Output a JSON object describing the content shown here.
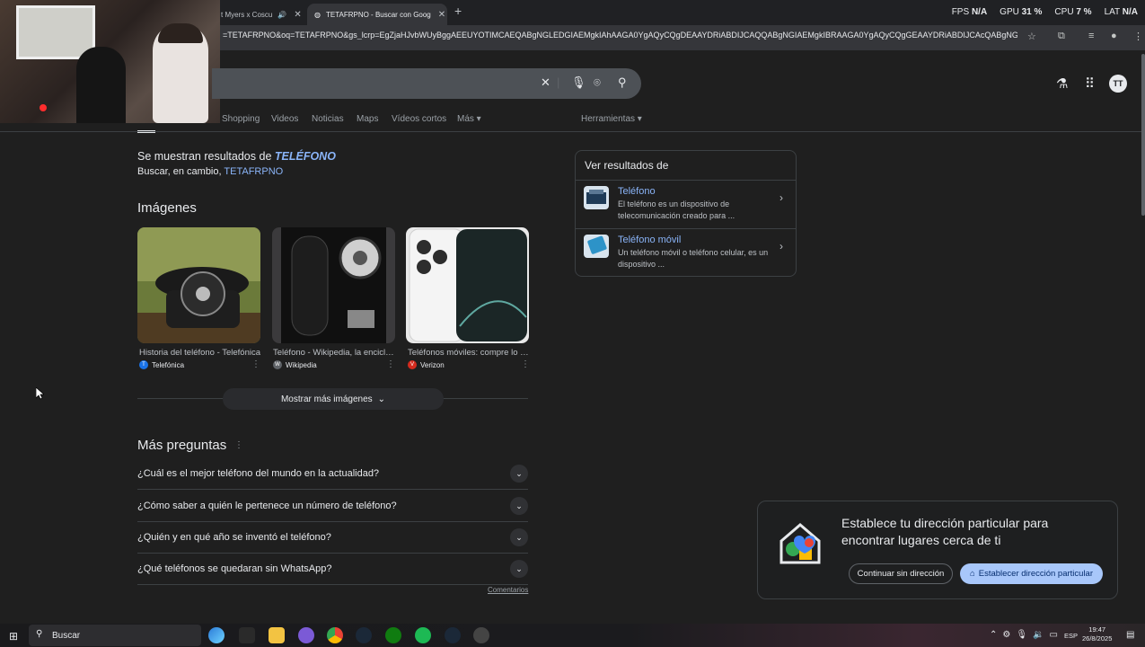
{
  "browser": {
    "tabs": [
      {
        "title": "t Myers x Coscu",
        "active": false
      },
      {
        "title": "TETAFRPNO - Buscar con Goog",
        "active": true
      }
    ],
    "new_tab": "+",
    "url": "=TETAFRPNO&oq=TETAFRPNO&gs_lcrp=EgZjaHJvbWUyBggAEEUYOTIMCAEQABgNGLEDGIAEMgkIAhAAGA0YgAQyCQgDEAAYDRiABDIJCAQQABgNGIAEMgkIBRAAGA0YgAQyCQgGEAAYDRiABDIJCAcQABgNGIAEM...",
    "stats": {
      "fps_label": "FPS",
      "fps_value": "N/A",
      "gpu_label": "GPU",
      "gpu_value": "31 %",
      "cpu_label": "CPU",
      "cpu_value": "7 %",
      "lat_label": "LAT",
      "lat_value": "N/A"
    }
  },
  "header": {
    "avatar_initials": "TT"
  },
  "nav": {
    "tabs": [
      "Shopping",
      "Videos",
      "Noticias",
      "Maps",
      "Vídeos cortos",
      "Más ▾"
    ],
    "tools": "Herramientas ▾"
  },
  "results": {
    "correction_prefix": "Se muestran resultados de ",
    "correction_term": "TELÉFONO",
    "instead_prefix": "Buscar, en cambio, ",
    "instead_term": "TETAFRPNO",
    "images_title": "Imágenes",
    "images": [
      {
        "caption": "Historia del teléfono - Telefónica",
        "source": "Telefónica",
        "badge": "T",
        "color": "#1a73e8"
      },
      {
        "caption": "Teléfono - Wikipedia, la enciclopedia libre",
        "source": "Wikipedia",
        "badge": "W",
        "color": "#5f6368"
      },
      {
        "caption": "Teléfonos móviles: compre lo último",
        "source": "Verizon",
        "badge": "V",
        "color": "#d52b1e"
      }
    ],
    "more_images": "Mostrar más imágenes",
    "paa_title": "Más preguntas",
    "questions": [
      "¿Cuál es el mejor teléfono del mundo en la actualidad?",
      "¿Cómo saber a quién le pertenece un número de teléfono?",
      "¿Quién y en qué año se inventó el teléfono?",
      "¿Qué teléfonos se quedaran sin WhatsApp?"
    ],
    "feedback": "Comentarios"
  },
  "side_panel": {
    "title": "Ver resultados de",
    "items": [
      {
        "name": "Teléfono",
        "desc": "El teléfono es un dispositivo de telecomunicación creado para ..."
      },
      {
        "name": "Teléfono móvil",
        "desc": "Un teléfono móvil o teléfono celular, es un dispositivo ..."
      }
    ]
  },
  "home_card": {
    "title": "Establece tu dirección particular para encontrar lugares cerca de ti",
    "continue_label": "Continuar sin dirección",
    "set_label": "Establecer dirección particular"
  },
  "taskbar": {
    "search_placeholder": "Buscar",
    "lang": "ESP",
    "time": "19:47",
    "date": "26/8/2025"
  }
}
